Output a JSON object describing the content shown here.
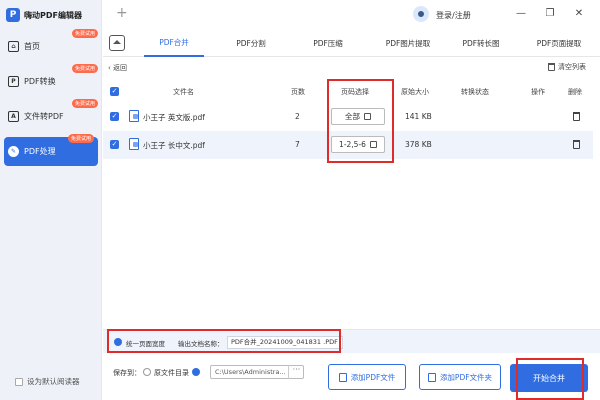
{
  "app": {
    "title": "嗨动PDF编辑器",
    "logo_char": "P"
  },
  "titlebar": {
    "plus_label": "+",
    "login_label": "登录/注册",
    "min_label": "—",
    "max_label": "❐",
    "close_label": "✕"
  },
  "sidebar": {
    "items": [
      {
        "label": "首页",
        "badge": "免费试用",
        "icon": "home-icon",
        "icon_glyph": "⌂"
      },
      {
        "label": "PDF转换",
        "badge": "免费试用",
        "icon": "convert-icon",
        "icon_glyph": "P"
      },
      {
        "label": "文件转PDF",
        "badge": "免费试用",
        "icon": "file-to-pdf-icon",
        "icon_glyph": "A"
      },
      {
        "label": "PDF处理",
        "badge": "免费试用",
        "icon": "process-icon",
        "icon_glyph": "✎",
        "active": true
      }
    ],
    "default_reader": "设为默认阅读器"
  },
  "tabs": [
    "PDF合并",
    "PDF分割",
    "PDF压缩",
    "PDF图片提取",
    "PDF转长图",
    "PDF页面提取"
  ],
  "active_tab": 0,
  "toolbar": {
    "back": "返回",
    "back_glyph": "‹",
    "clear": "清空列表"
  },
  "table": {
    "headers": {
      "filename": "文件名",
      "pages": "页数",
      "page_select": "页码选择",
      "orig_size": "原始大小",
      "status": "转换状态",
      "action": "操作",
      "delete": "删除"
    },
    "rows": [
      {
        "name": "小王子 英文版.pdf",
        "pages": "2",
        "page_select": "全部",
        "size": "141 KB",
        "selected": false
      },
      {
        "name": "小王子 长中文.pdf",
        "pages": "7",
        "page_select": "1-2,5-6",
        "size": "378 KB",
        "selected": true
      }
    ]
  },
  "options": {
    "unify_width": "统一页面宽度",
    "output_label": "输出文档名称：",
    "output_name": "PDF合并_20241009_041831 .PDF",
    "check_glyph": "✓"
  },
  "bottom": {
    "save_to": "保存到：",
    "source_dir": "原文件目录",
    "path": "C:\\Users\\Administra...",
    "dots": "···",
    "add_file": "添加PDF文件",
    "add_folder": "添加PDF文件夹",
    "start": "开始合并"
  },
  "colors": {
    "accent": "#2f6de1",
    "highlight": "#e02b2b",
    "badge": "#ff6b4a"
  }
}
